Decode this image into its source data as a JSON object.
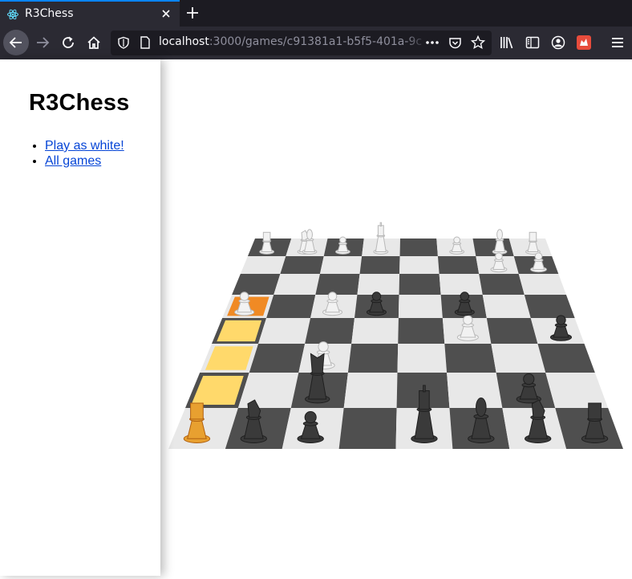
{
  "browser": {
    "tab_title": "R3Chess",
    "url_host": "localhost",
    "url_path": ":3000/games/c91381a1-b5f5-401a-9c",
    "icons": [
      "react-favicon-icon",
      "close-icon",
      "plus-icon",
      "back-arrow-icon",
      "forward-arrow-icon",
      "reload-icon",
      "home-icon",
      "shield-icon",
      "page-icon",
      "more-icon",
      "pocket-icon",
      "star-icon",
      "library-icon",
      "sidebar-icon",
      "account-icon",
      "extension-icon",
      "hamburger-menu-icon"
    ]
  },
  "sidebar": {
    "title": "R3Chess",
    "links": [
      {
        "label": "Play as white!"
      },
      {
        "label": "All games"
      }
    ]
  },
  "board": {
    "light_square": "#e8e8e8",
    "dark_square": "#4f4f4f",
    "selected_color": "#f08a24",
    "highlight_color": "#ffd96b"
  }
}
